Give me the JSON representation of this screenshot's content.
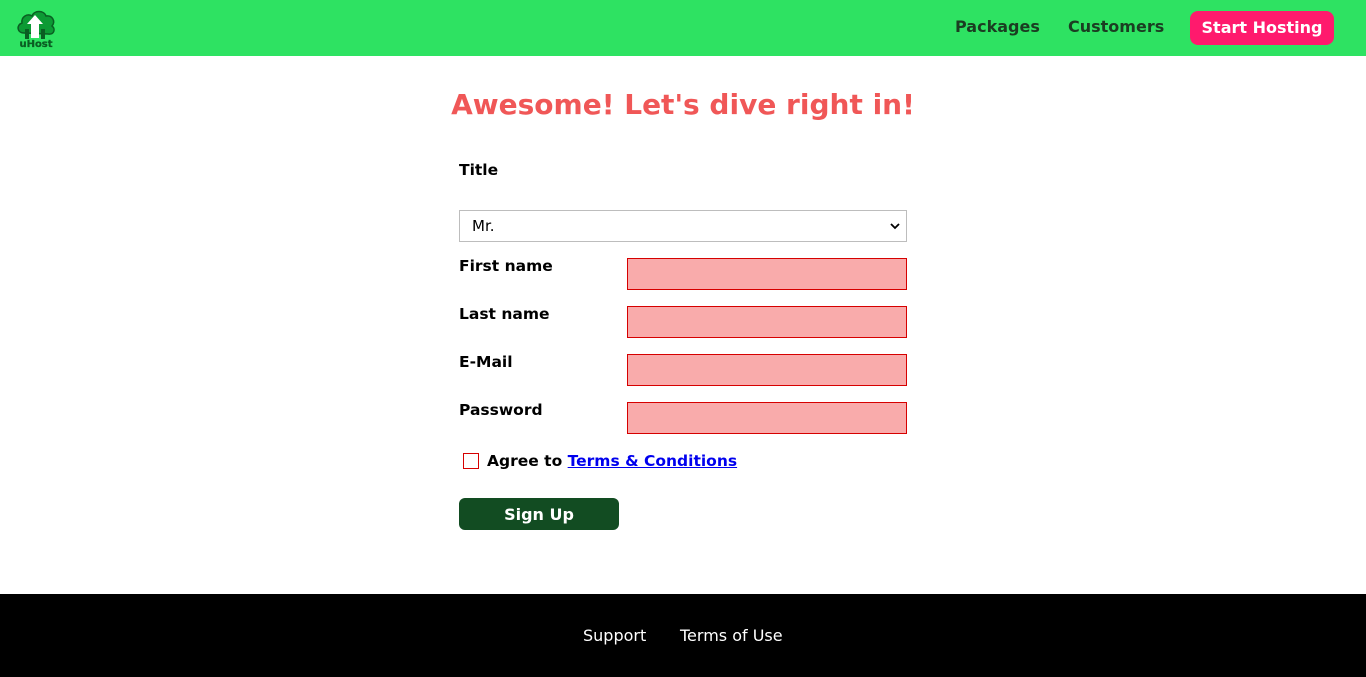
{
  "header": {
    "logo_text": "uHost",
    "nav": [
      "Packages",
      "Customers"
    ],
    "cta": "Start Hosting",
    "colors": {
      "background": "#2ee262",
      "cta": "#ff1a6d",
      "nav_text": "#1b3d22"
    }
  },
  "main": {
    "headline": "Awesome! Let's dive right in!",
    "title_label": "Title",
    "title_selected": "Mr.",
    "fields": [
      {
        "label": "First name",
        "value": ""
      },
      {
        "label": "Last name",
        "value": ""
      },
      {
        "label": "E-Mail",
        "value": ""
      },
      {
        "label": "Password",
        "value": ""
      }
    ],
    "agree_text": "Agree to",
    "terms_link": "Terms & Conditions",
    "submit": "Sign Up",
    "colors": {
      "headline": "#f05757",
      "invalid_fill": "#f9abab",
      "invalid_border": "#d60000",
      "submit": "#124c22"
    }
  },
  "footer": {
    "links": [
      "Support",
      "Terms of Use"
    ]
  },
  "icons": {
    "logo": "cloud-upload-logo-icon",
    "select": "chevron-down-icon"
  }
}
